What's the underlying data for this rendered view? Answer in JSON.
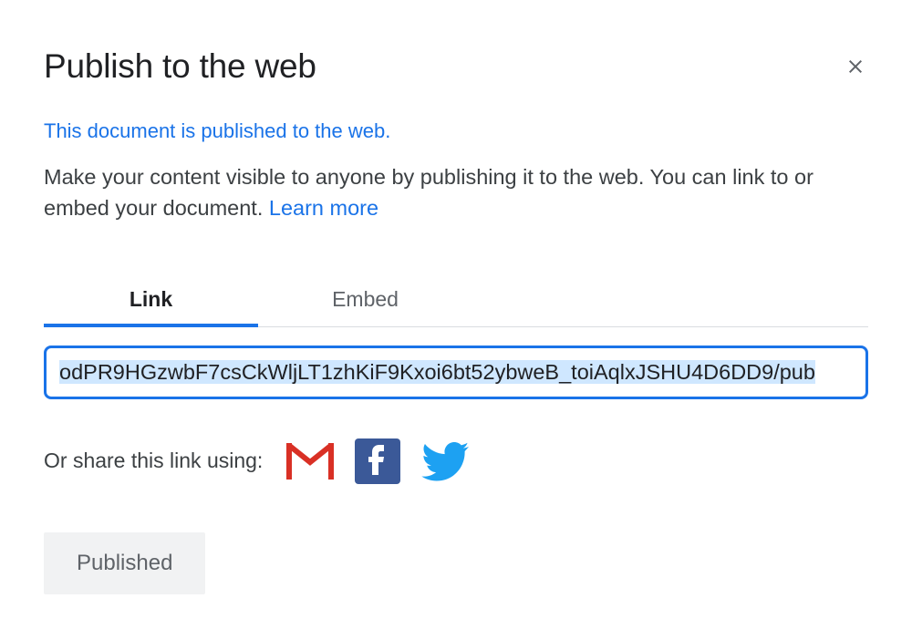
{
  "dialog": {
    "title": "Publish to the web",
    "status": "This document is published to the web.",
    "description": "Make your content visible to anyone by publishing it to the web. You can link to or embed your document. ",
    "learn_more": "Learn more"
  },
  "tabs": {
    "link": "Link",
    "embed": "Embed",
    "active": "link"
  },
  "url": "odPR9HGzwbF7csCkWljLT1zhKiF9Kxoi6bt52ybweB_toiAqlxJSHU4D6DD9/pub",
  "share": {
    "label": "Or share this link using:",
    "options": [
      "gmail",
      "facebook",
      "twitter"
    ]
  },
  "button": {
    "published": "Published"
  },
  "colors": {
    "accent": "#1a73e8",
    "text": "#3c4043",
    "muted": "#5f6368"
  }
}
